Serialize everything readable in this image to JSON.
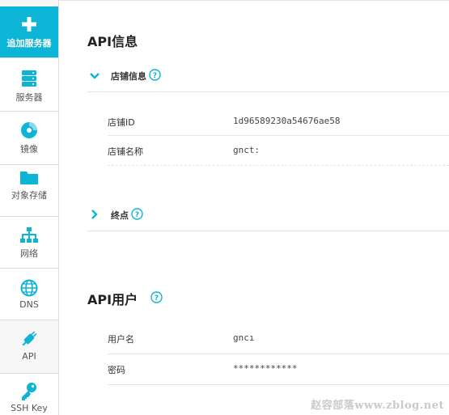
{
  "sidebar": {
    "items": [
      {
        "label": "追加服务器",
        "icon": "plus-icon"
      },
      {
        "label": "服务器",
        "icon": "server-icon"
      },
      {
        "label": "镜像",
        "icon": "disc-icon"
      },
      {
        "label": "对象存储",
        "icon": "folder-icon"
      },
      {
        "label": "网络",
        "icon": "network-icon"
      },
      {
        "label": "DNS",
        "icon": "globe-icon"
      },
      {
        "label": "API",
        "icon": "plug-icon"
      },
      {
        "label": "SSH Key",
        "icon": "key-icon"
      }
    ]
  },
  "api_info": {
    "title": "API信息",
    "store_section": {
      "title": "店铺信息",
      "rows": [
        {
          "key": "店铺ID",
          "value": "1d96589230a54676ae58"
        },
        {
          "key": "店铺名称",
          "value": "gnct:"
        }
      ]
    },
    "endpoint_section": {
      "title": "终点"
    }
  },
  "api_user": {
    "title": "API用户",
    "rows": [
      {
        "key": "用户名",
        "value": "gncı"
      },
      {
        "key": "密码",
        "value": "************"
      }
    ]
  },
  "watermark": "赵容部落www.zblog.net",
  "colors": {
    "accent": "#0cb4d6",
    "sidebar_bg": "#f6f6f6",
    "border": "#e2e2e2"
  }
}
